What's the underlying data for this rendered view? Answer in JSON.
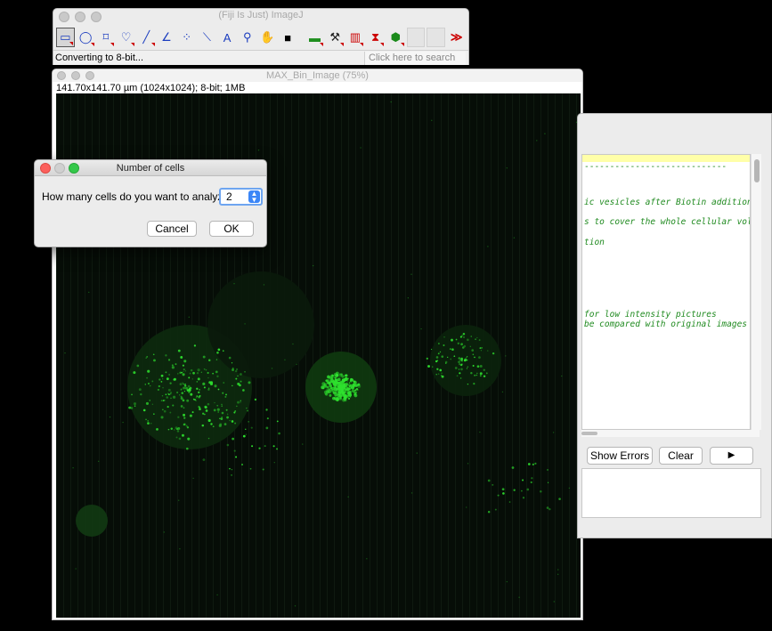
{
  "imagej": {
    "title": "(Fiji Is Just) ImageJ",
    "status": "Converting to 8-bit...",
    "search_placeholder": "Click here to search",
    "tools": [
      {
        "name": "rectangle-tool-icon",
        "glyph": "▭"
      },
      {
        "name": "oval-tool-icon",
        "glyph": "◯"
      },
      {
        "name": "polygon-tool-icon",
        "glyph": "⌑"
      },
      {
        "name": "freehand-tool-icon",
        "glyph": "♡"
      },
      {
        "name": "line-tool-icon",
        "glyph": "╱"
      },
      {
        "name": "angle-tool-icon",
        "glyph": "∠"
      },
      {
        "name": "point-tool-icon",
        "glyph": "⁘"
      },
      {
        "name": "wand-tool-icon",
        "glyph": "⟍"
      },
      {
        "name": "text-tool-icon",
        "glyph": "A"
      },
      {
        "name": "magnifier-tool-icon",
        "glyph": "⚲"
      },
      {
        "name": "hand-tool-icon",
        "glyph": "✋"
      },
      {
        "name": "color-picker-icon",
        "glyph": "■"
      }
    ],
    "more_tools_glyph": "≫"
  },
  "image_window": {
    "title": "MAX_Bin_Image (75%)",
    "info": "141.70x141.70 µm (1024x1024); 8-bit; 1MB"
  },
  "log": {
    "lines": [
      "----------------------------",
      "ic vesicles after Biotin addition",
      "s to cover the whole cellular volu",
      "tion",
      "for low intensity pictures",
      "be compared with original images t"
    ],
    "buttons": {
      "show_errors": "Show Errors",
      "clear": "Clear",
      "run": "▶"
    }
  },
  "dialog": {
    "title": "Number of cells",
    "prompt": "How many cells do you want to analyze?",
    "value": "2",
    "cancel": "Cancel",
    "ok": "OK"
  },
  "colors": {
    "cell_green": "#2ee02e",
    "log_text_green": "#1f8a1f",
    "accent_blue": "#3b86f7"
  }
}
